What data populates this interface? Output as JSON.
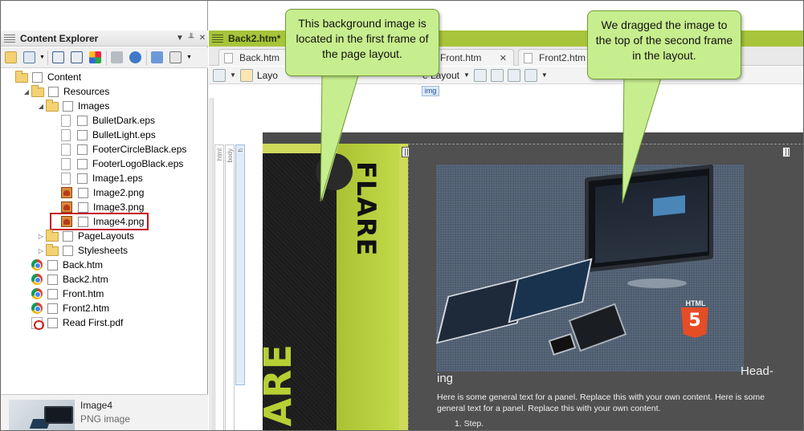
{
  "content_explorer": {
    "title": "Content Explorer",
    "pin_label": "▼  ╨  ✕",
    "tree": [
      {
        "label": "Content",
        "type": "folder",
        "level": 0
      },
      {
        "label": "Resources",
        "type": "folder",
        "level": 1
      },
      {
        "label": "Images",
        "type": "folder",
        "level": 2
      },
      {
        "label": "BulletDark.eps",
        "type": "doc",
        "level": 3
      },
      {
        "label": "BulletLight.eps",
        "type": "doc",
        "level": 3
      },
      {
        "label": "FooterCircleBlack.eps",
        "type": "doc",
        "level": 3
      },
      {
        "label": "FooterLogoBlack.eps",
        "type": "doc",
        "level": 3
      },
      {
        "label": "Image1.eps",
        "type": "doc",
        "level": 3
      },
      {
        "label": "Image2.png",
        "type": "png",
        "level": 3
      },
      {
        "label": "Image3.png",
        "type": "png",
        "level": 3
      },
      {
        "label": "Image4.png",
        "type": "png",
        "level": 3,
        "selected": true
      },
      {
        "label": "PageLayouts",
        "type": "folder",
        "level": 2
      },
      {
        "label": "Stylesheets",
        "type": "folder",
        "level": 2
      },
      {
        "label": "Back.htm",
        "type": "htm",
        "level": 1
      },
      {
        "label": "Back2.htm",
        "type": "htm",
        "level": 1
      },
      {
        "label": "Front.htm",
        "type": "htm",
        "level": 1
      },
      {
        "label": "Front2.htm",
        "type": "htm",
        "level": 1
      },
      {
        "label": "Read First.pdf",
        "type": "pdf",
        "level": 1
      }
    ],
    "preview": {
      "name": "Image4",
      "type": "PNG image"
    }
  },
  "editor": {
    "doc_title": "Back2.htm*",
    "tabs": [
      {
        "label": "Back.htm"
      },
      {
        "label": "Front.htm",
        "close": "✕"
      },
      {
        "label": "Front2.htm"
      }
    ],
    "toolbar": {
      "layout_left": "Layo",
      "layout_right": "e Layout"
    },
    "img_tag": "img",
    "structure_bars": [
      "html",
      "body",
      "h"
    ],
    "flare_top": "FLARE",
    "flare_big": "ARE",
    "heading_right": "Head-",
    "heading_left": "ing",
    "panel_text": "Here is some general text for a panel. Replace this with your own content. Here is some general text for a panel. Replace this with your own content.",
    "step": "1.    Step."
  },
  "callouts": {
    "left": "This background image is located in the first frame of the page layout.",
    "right": "We dragged the image to the top of the second frame in the layout."
  },
  "colors": {
    "title_bar": "#a8c43a",
    "callout_fill": "#c7ee8e",
    "selection_outline": "#c4121a",
    "page_bg": "#505050"
  }
}
